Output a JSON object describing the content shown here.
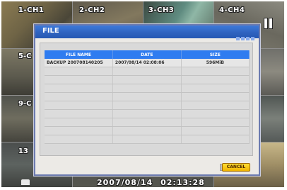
{
  "cameras": {
    "top_labels": [
      "1-CH1",
      "2-CH2",
      "3-CH3",
      "4-CH4"
    ],
    "side_labels": [
      "5-C",
      "9-C",
      "13"
    ]
  },
  "status": {
    "date": "2007/08/14",
    "time": "02:13:28"
  },
  "dialog": {
    "title": "FILE",
    "columns": [
      "FILE NAME",
      "DATE",
      "SIZE"
    ],
    "rows": [
      {
        "name": "BACKUP 200708140205",
        "date": "2007/08/14 02:08:06",
        "size": "596MiB"
      }
    ],
    "cancel_label": "CANCEL",
    "prev_icon": "up-arrow-icon",
    "next_icon": "down-arrow-icon"
  },
  "colors": {
    "header": "#2f63c0",
    "table_header": "#2f7cf0",
    "cancel": "#f7c300"
  }
}
